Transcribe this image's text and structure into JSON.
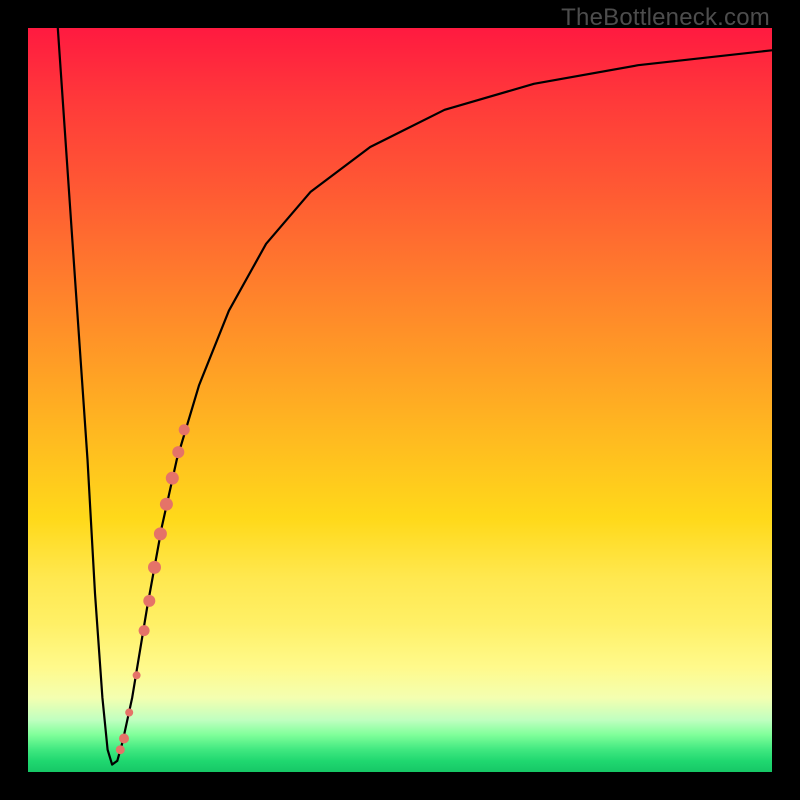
{
  "watermark": "TheBottleneck.com",
  "colors": {
    "frame": "#000000",
    "curve": "#000000",
    "dots": "#e57368"
  },
  "chart_data": {
    "type": "line",
    "title": "",
    "xlabel": "",
    "ylabel": "",
    "xlim": [
      0,
      100
    ],
    "ylim": [
      0,
      100
    ],
    "series": [
      {
        "name": "bottleneck-curve",
        "x": [
          4,
          6,
          8,
          9,
          10,
          10.7,
          11.3,
          12,
          12.7,
          14,
          16,
          18,
          20,
          23,
          27,
          32,
          38,
          46,
          56,
          68,
          82,
          100
        ],
        "y": [
          100,
          71,
          42,
          24,
          10,
          3,
          1,
          1.5,
          4,
          10,
          22,
          33,
          42,
          52,
          62,
          71,
          78,
          84,
          89,
          92.5,
          95,
          97
        ]
      }
    ],
    "dots": {
      "name": "highlighted-points",
      "points": [
        {
          "x": 12.4,
          "y": 3.0,
          "r": 4.5
        },
        {
          "x": 12.9,
          "y": 4.5,
          "r": 5.0
        },
        {
          "x": 13.6,
          "y": 8.0,
          "r": 4.0
        },
        {
          "x": 14.6,
          "y": 13.0,
          "r": 4.0
        },
        {
          "x": 15.6,
          "y": 19.0,
          "r": 5.5
        },
        {
          "x": 16.3,
          "y": 23.0,
          "r": 6.0
        },
        {
          "x": 17.0,
          "y": 27.5,
          "r": 6.5
        },
        {
          "x": 17.8,
          "y": 32.0,
          "r": 6.5
        },
        {
          "x": 18.6,
          "y": 36.0,
          "r": 6.5
        },
        {
          "x": 19.4,
          "y": 39.5,
          "r": 6.5
        },
        {
          "x": 20.2,
          "y": 43.0,
          "r": 6.0
        },
        {
          "x": 21.0,
          "y": 46.0,
          "r": 5.5
        }
      ]
    }
  }
}
